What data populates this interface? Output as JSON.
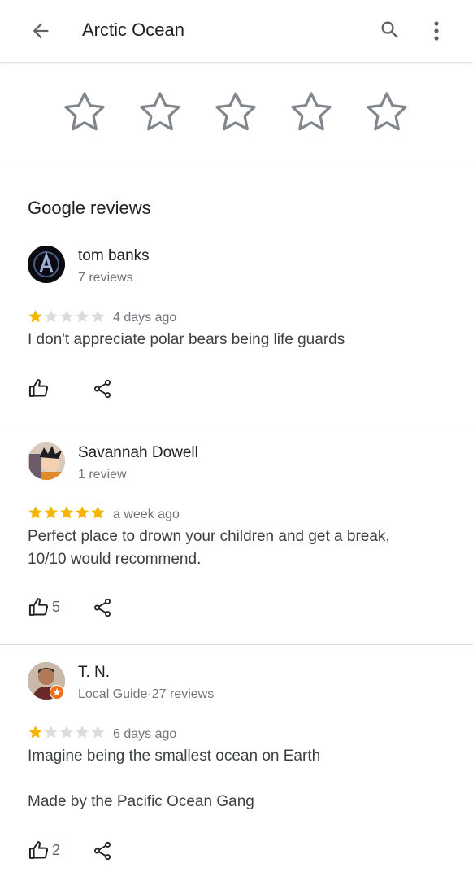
{
  "header": {
    "title": "Arctic Ocean",
    "back_icon": "arrow-back-icon",
    "search_icon": "search-icon",
    "more_icon": "more-vert-icon"
  },
  "rate": {
    "stars": 5,
    "selected": 0
  },
  "section_title": "Google reviews",
  "colors": {
    "star_filled": "#f4b400",
    "star_empty": "#dadce0",
    "outline": "#80868b"
  },
  "reviews": [
    {
      "author": "tom banks",
      "meta": "7 reviews",
      "rating": 1,
      "date": "4 days ago",
      "text": [
        "I don't appreciate polar bears being life guards"
      ],
      "likes": ""
    },
    {
      "author": "Savannah Dowell",
      "meta": "1 review",
      "rating": 5,
      "date": "a week ago",
      "text": [
        "Perfect place to drown your children and get a break,",
        "10/10 would recommend."
      ],
      "likes": "5"
    },
    {
      "author": "T. N.",
      "meta": "Local Guide·27 reviews",
      "rating": 1,
      "date": "6 days ago",
      "text": [
        "Imagine being the smallest ocean on Earth",
        "",
        "Made by the Pacific Ocean Gang"
      ],
      "likes": "2"
    }
  ]
}
